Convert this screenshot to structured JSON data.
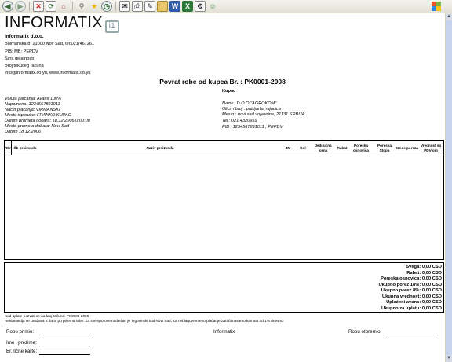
{
  "toolbar": {
    "buttons": [
      "back-icon",
      "forward-icon",
      "stop-icon",
      "refresh-icon",
      "home-icon",
      "search-icon",
      "favorites-icon",
      "history-icon",
      "mail-icon",
      "print-icon",
      "edit-icon",
      "folder-icon",
      "word-icon",
      "excel-icon",
      "tools-icon",
      "messenger-icon"
    ]
  },
  "header": {
    "logo_text": "INFORMATIX",
    "logo_mark": "i1",
    "company_name": "Informatix d.o.o.",
    "address": "Bolmanska 8, 21000 Nov Sad, tel:021/467261",
    "pib_mb": "PIB:  MB:    PEPDV",
    "sifra": "Šifra delatnosti",
    "racun": "Broj tekućeg računa",
    "contact": "info@informatix.co.yu, www.informatix.co.yu"
  },
  "document": {
    "title": "Povrat robe od kupca   Br. : PK0001-2008",
    "kupac_heading": "Kupac"
  },
  "left_fields": [
    "Valuta plaćanja: Avans 100%",
    "Napomena: 1234567891011",
    "Način plaćanja: VIRMANSKI",
    "Mesto isporuke: FRANKO KUPAC",
    "Datum prometa dobara: 18.12.2006 0:00:00",
    "Mesto prometa dobara: Novi Sad",
    "Datum 18.12.2006"
  ],
  "right_fields": [
    "Naziv : D.O.O \"AGROKOM\"",
    "Ulica i broj : patrijarha rajacica",
    "Mesto : novi sad vojvodina, 21131 SRBIJA",
    "Tel.: 021 4320959",
    "PIB : 1234567891011 , PEPDV"
  ],
  "table": {
    "columns": [
      "Rbr",
      "Šb proizvoda",
      "Naziv proizvoda",
      "JM",
      "Kol",
      "Jedinična cena",
      "Rabat",
      "Poreska osnovica",
      "Poreska Stopa",
      "Iznos poreza",
      "Vrednost sa PDV-om"
    ]
  },
  "totals": [
    "Svega: 0,00 CSD",
    "Rabat: 0,00 CSD",
    "Poreska osnovica: 0,00 CSD",
    "Ukupno porez 18%: 0,00 CSD",
    "Ukupno porez 8%: 0,00 CSD",
    "Ukupna vrednost: 0,00 CSD",
    "Uplaćeni avans: 0,00 CSD",
    "Ukupno za uplatu: 0,00 CSD"
  ],
  "footer": {
    "note1": "Kod uplate pozvati se na broj računa: PK0001-2008",
    "note2": "Reklamacija se uvažava 8 dana po prijemu robe. Za sve sporove nadležan je Trgovinski sud Novi Sad. Za neblagovremeno plaćanje zaračunavamo kamatu od 1% dnevno.",
    "robu_primio": "Robu primio:",
    "company": "Informatix",
    "robu_otpremio": "Robu otpremio:",
    "ime_prezime": "Ime i prezime:",
    "br_licne": "Br. lične karte:"
  }
}
